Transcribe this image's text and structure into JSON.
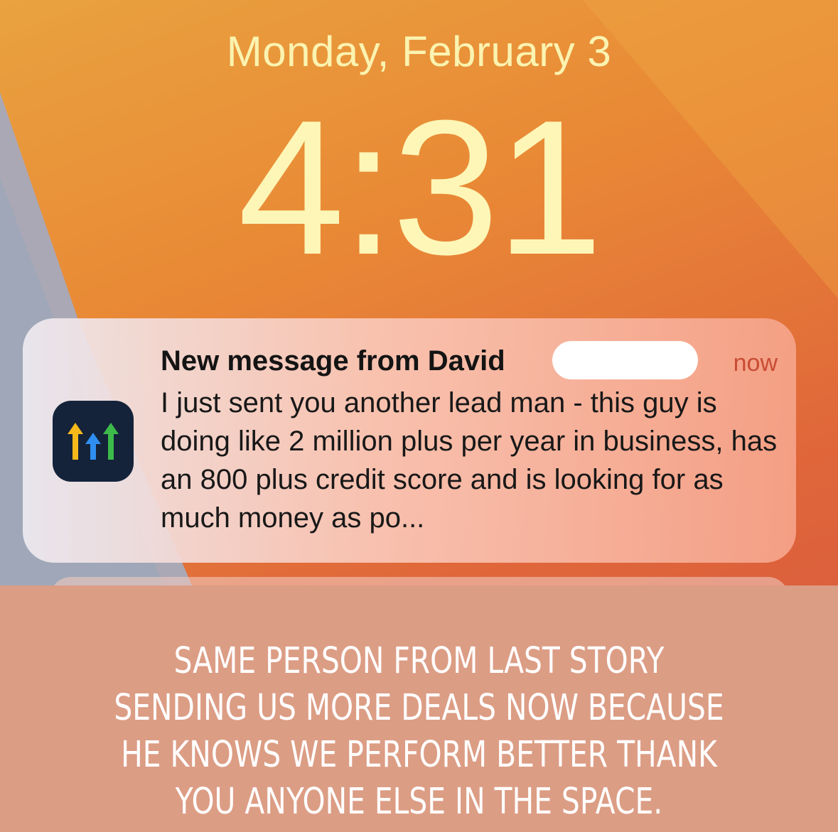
{
  "lock_screen": {
    "date": "Monday, February 3",
    "time": "4:31"
  },
  "notification": {
    "app_icon": "gohighlevel-arrows-icon",
    "title": "New message from David",
    "timestamp": "now",
    "body": "I just sent you another lead man - this guy is doing like 2 million plus per year in business, has an 800 plus credit score and is looking for as much money as po..."
  },
  "caption": {
    "text": "SAME PERSON FROM LAST STORY SENDING US MORE DEALS NOW BECAUSE HE KNOWS WE PERFORM BETTER THANK YOU ANYONE ELSE IN THE SPACE."
  },
  "colors": {
    "clock": "#fdf6b7",
    "timestamp": "#c84c34",
    "caption_panel": "#dc9d85"
  }
}
